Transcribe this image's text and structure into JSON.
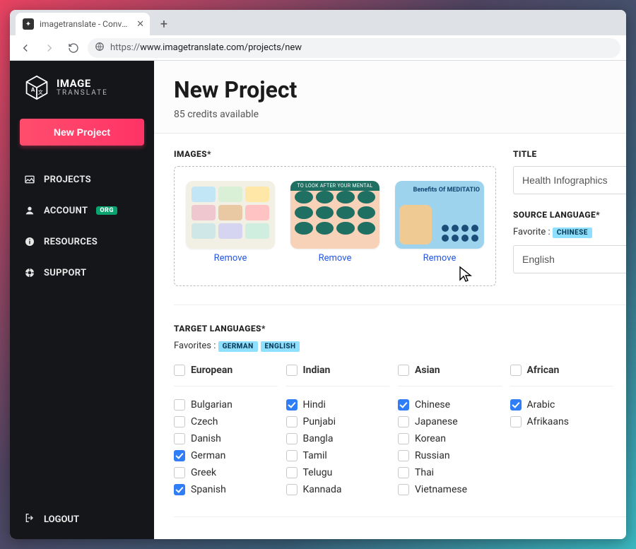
{
  "browser": {
    "tab_title": "imagetranslate - Convert imag",
    "url_https": "https://",
    "url_rest": "www.imagetranslate.com/projects/new"
  },
  "sidebar": {
    "brand_line1": "IMAGE",
    "brand_line2": "TRANSLATE",
    "new_project_label": "New Project",
    "items": [
      {
        "label": "PROJECTS"
      },
      {
        "label": "ACCOUNT"
      },
      {
        "label": "RESOURCES"
      },
      {
        "label": "SUPPORT"
      }
    ],
    "org_badge": "ORG",
    "logout_label": "LOGOUT"
  },
  "header": {
    "title": "New Project",
    "credits": "85 credits available"
  },
  "images": {
    "label": "IMAGES*",
    "remove_label": "Remove",
    "thumb2_band": "TO LOOK AFTER YOUR MENTAL",
    "thumb3_caption": "Benefits Of MEDITATIO"
  },
  "title_field": {
    "label": "TITLE",
    "value": "Health Infographics"
  },
  "source_lang": {
    "label": "SOURCE LANGUAGE*",
    "favorite_label": "Favorite :",
    "favorite_chip": "CHINESE",
    "value": "English"
  },
  "target_langs": {
    "label": "TARGET LANGUAGES*",
    "favorites_label": "Favorites :",
    "chips": [
      "GERMAN",
      "ENGLISH"
    ],
    "columns": [
      {
        "header": "European",
        "items": [
          {
            "label": "Bulgarian",
            "checked": false
          },
          {
            "label": "Czech",
            "checked": false
          },
          {
            "label": "Danish",
            "checked": false
          },
          {
            "label": "German",
            "checked": true
          },
          {
            "label": "Greek",
            "checked": false
          },
          {
            "label": "Spanish",
            "checked": true
          }
        ]
      },
      {
        "header": "Indian",
        "items": [
          {
            "label": "Hindi",
            "checked": true
          },
          {
            "label": "Punjabi",
            "checked": false
          },
          {
            "label": "Bangla",
            "checked": false
          },
          {
            "label": "Tamil",
            "checked": false
          },
          {
            "label": "Telugu",
            "checked": false
          },
          {
            "label": "Kannada",
            "checked": false
          }
        ]
      },
      {
        "header": "Asian",
        "items": [
          {
            "label": "Chinese",
            "checked": true
          },
          {
            "label": "Japanese",
            "checked": false
          },
          {
            "label": "Korean",
            "checked": false
          },
          {
            "label": "Russian",
            "checked": false
          },
          {
            "label": "Thai",
            "checked": false
          },
          {
            "label": "Vietnamese",
            "checked": false
          }
        ]
      },
      {
        "header": "African",
        "items": [
          {
            "label": "Arabic",
            "checked": true
          },
          {
            "label": "Afrikaans",
            "checked": false
          }
        ]
      }
    ]
  }
}
